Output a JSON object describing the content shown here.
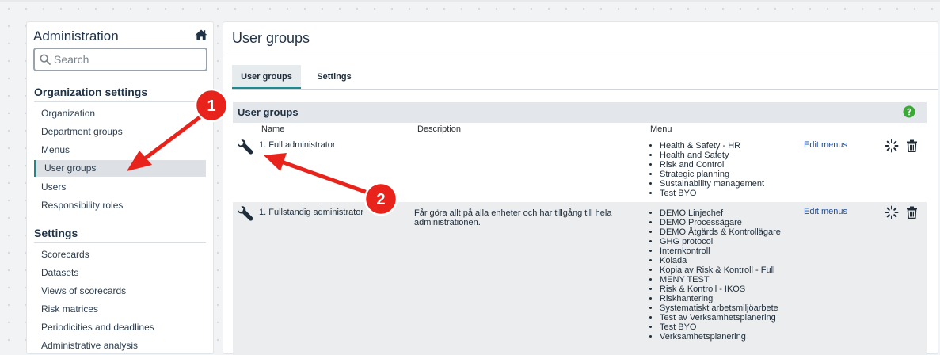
{
  "sidebar": {
    "title": "Administration",
    "search_placeholder": "Search",
    "sections": [
      {
        "heading": "Organization settings",
        "items": [
          "Organization",
          "Department groups",
          "Menus",
          "User groups",
          "Users",
          "Responsibility roles"
        ]
      },
      {
        "heading": "Settings",
        "items": [
          "Scorecards",
          "Datasets",
          "Views of scorecards",
          "Risk matrices",
          "Periodicities and deadlines",
          "Administrative analysis"
        ]
      }
    ],
    "active_item": "User groups"
  },
  "main": {
    "title": "User groups",
    "tabs": [
      "User groups",
      "Settings"
    ],
    "active_tab": "User groups",
    "panel_title": "User groups",
    "columns": [
      "Name",
      "Description",
      "Menu"
    ],
    "rows": [
      {
        "name": "1. Full administrator",
        "description": "",
        "menus": [
          "Health & Safety - HR",
          "Health and Safety",
          "Risk and Control",
          "Strategic planning",
          "Sustainability management",
          "Test BYO"
        ],
        "action": "Edit menus"
      },
      {
        "name": "1. Fullstandig administrator",
        "description": "Får göra allt på alla enheter och har tillgång till hela administrationen.",
        "menus": [
          "DEMO Linjechef",
          "DEMO Processägare",
          "DEMO Åtgärds & Kontrollägare",
          "GHG protocol",
          "Internkontroll",
          "Kolada",
          "Kopia av Risk & Kontroll - Full",
          "MENY TEST",
          "Risk & Kontroll - IKOS",
          "Riskhantering",
          "Systematiskt arbetsmiljöarbete",
          "Test av Verksamhetsplanering",
          "Test BYO",
          "Verksamhetsplanering"
        ],
        "action": "Edit menus"
      }
    ]
  },
  "annotations": [
    "1",
    "2"
  ],
  "colors": {
    "accent": "#1a8a8e",
    "link": "#1d4fa3",
    "annotation": "#e8231b",
    "help": "#3aa935"
  },
  "icons": [
    "home-icon",
    "search-icon",
    "help-icon",
    "wrench-icon",
    "spinner-icon",
    "trash-icon",
    "arrow"
  ]
}
